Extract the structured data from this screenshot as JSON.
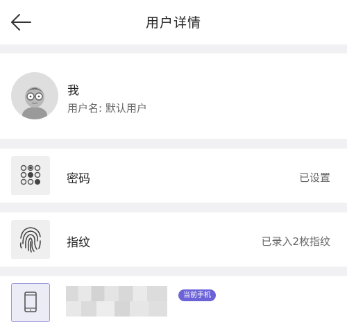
{
  "header": {
    "title": "用户详情",
    "back_icon": "arrow-left-icon"
  },
  "profile": {
    "name": "我",
    "username_line": "用户名: 默认用户",
    "avatar_icon": "user-avatar-icon"
  },
  "rows": [
    {
      "icon": "keypad-icon",
      "label": "密码",
      "value": "已设置"
    },
    {
      "icon": "fingerprint-icon",
      "label": "指纹",
      "value": "已录入2枚指纹"
    }
  ],
  "device": {
    "icon": "phone-icon",
    "badge": "当前手机"
  },
  "colors": {
    "accent": "#6d63d9",
    "background": "#f1f0f3",
    "card": "#ffffff"
  }
}
